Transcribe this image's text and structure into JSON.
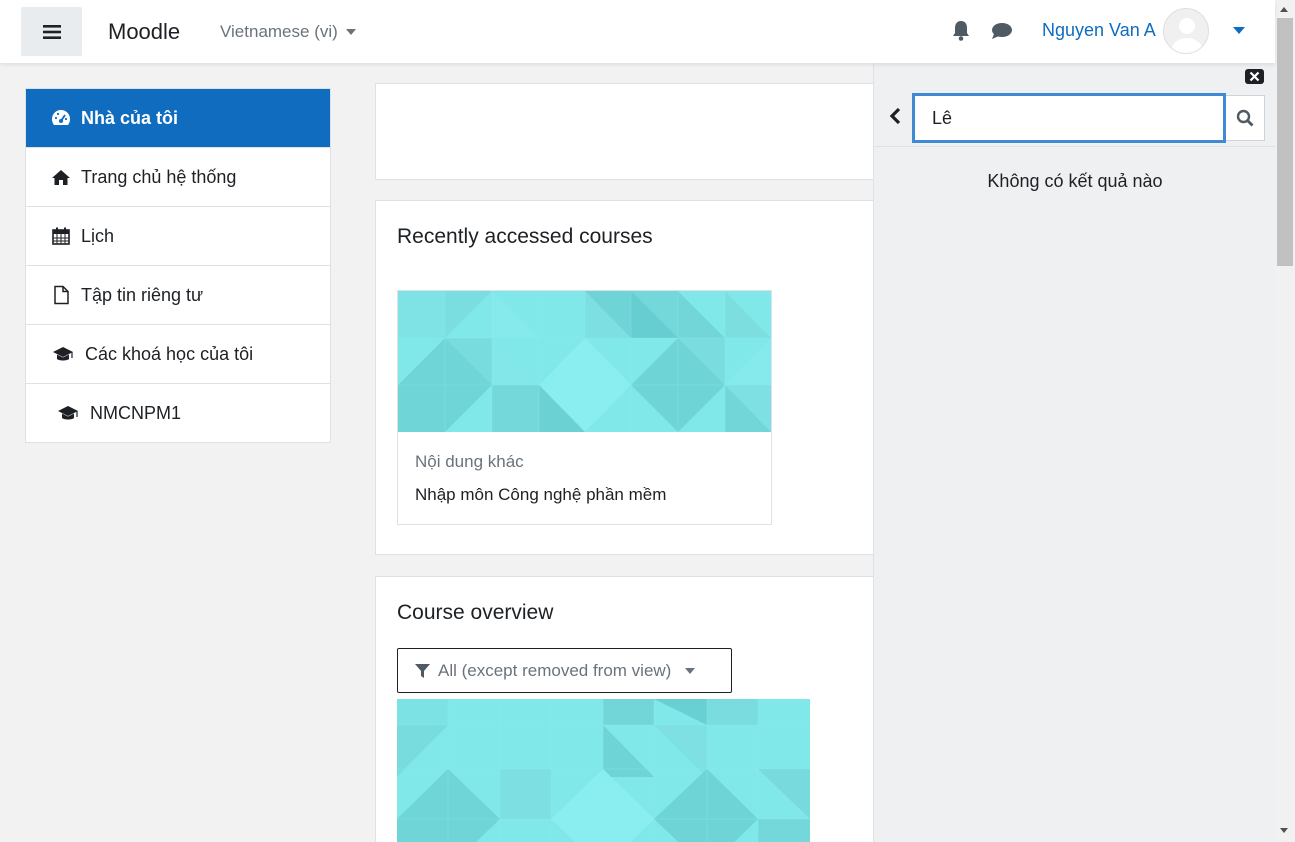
{
  "navbar": {
    "brand": "Moodle",
    "language": "Vietnamese (vi)",
    "user_name": "Nguyen Van A",
    "icons": [
      "menu-icon",
      "bell-icon",
      "chat-icon",
      "avatar",
      "chevron-down-icon"
    ],
    "link_color": "#0f6cbf"
  },
  "sidebar": {
    "items": [
      {
        "label": "Nhà của tôi",
        "icon": "dashboard-icon",
        "active": true
      },
      {
        "label": "Trang chủ hệ thống",
        "icon": "home-icon"
      },
      {
        "label": "Lịch",
        "icon": "calendar-icon"
      },
      {
        "label": "Tập tin riêng tư",
        "icon": "file-icon"
      },
      {
        "label": "Các khoá học của tôi",
        "icon": "graduation-cap-icon"
      },
      {
        "label": "NMCNPM1",
        "icon": "graduation-cap-icon"
      }
    ],
    "active_color": "#0f6cbf"
  },
  "main": {
    "recent": {
      "title": "Recently accessed courses",
      "course": {
        "category": "Nội dung khác",
        "name": "Nhập môn Công nghệ phần mềm"
      }
    },
    "overview": {
      "title": "Course overview",
      "filter_label": "All (except removed from view)"
    }
  },
  "message_drawer": {
    "search_value": "Lê",
    "no_results": "Không có kết quả nào",
    "icons": [
      "close-icon",
      "back-icon",
      "search-icon"
    ],
    "focus_color": "#3f8ad2"
  }
}
